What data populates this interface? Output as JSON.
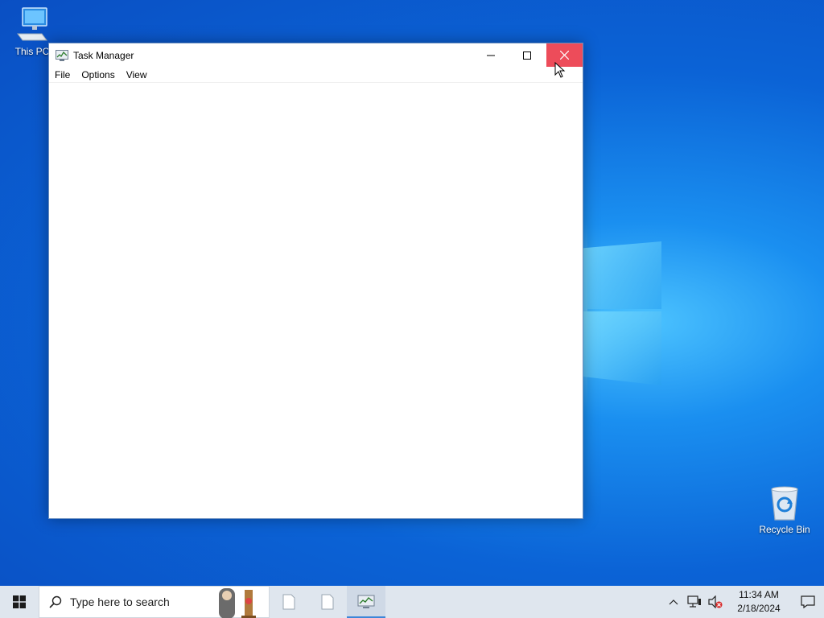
{
  "desktop": {
    "icons": [
      {
        "label": "This PC",
        "icon": "computer-icon"
      },
      {
        "label": "Recycle Bin",
        "icon": "recycle-bin-icon"
      }
    ]
  },
  "window": {
    "title": "Task Manager",
    "icon": "task-manager-icon",
    "menu": [
      "File",
      "Options",
      "View"
    ],
    "controls": {
      "minimize": "minimize-icon",
      "maximize": "maximize-icon",
      "close": "close-icon"
    },
    "close_hover_color": "#e81123"
  },
  "taskbar": {
    "search_placeholder": "Type here to search",
    "apps": [
      {
        "name": "blank-document-app",
        "icon": "document-icon"
      },
      {
        "name": "blank-document-app-2",
        "icon": "document-icon"
      },
      {
        "name": "task-manager-app",
        "icon": "task-manager-icon",
        "active": true
      }
    ],
    "clock": {
      "time": "11:34 AM",
      "date": "2/18/2024"
    },
    "accent_color": "#3c86d8"
  }
}
